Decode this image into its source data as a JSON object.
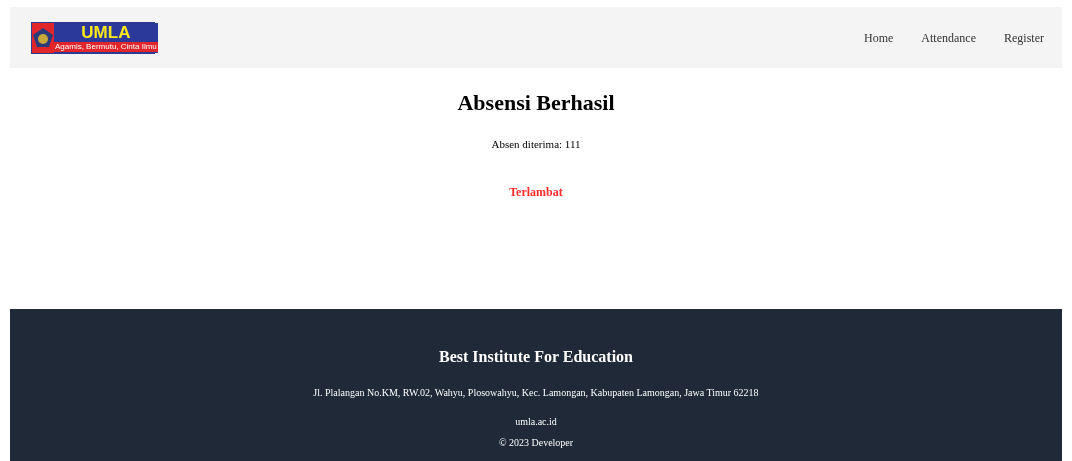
{
  "header": {
    "logo": {
      "text": "UMLA",
      "tagline": "Agamis, Bermutu, Cinta Ilmu"
    },
    "nav": [
      {
        "label": "Home"
      },
      {
        "label": "Attendance"
      },
      {
        "label": "Register"
      }
    ]
  },
  "main": {
    "title": "Absensi Berhasil",
    "message": "Absen diterima: 111",
    "status": {
      "text": "Terlambat",
      "color": "#ff2b2b"
    }
  },
  "footer": {
    "title": "Best Institute For Education",
    "address": "Jl. Plalangan No.KM, RW.02, Wahyu, Plosowahyu, Kec. Lamongan, Kabupaten Lamongan, Jawa Timur 62218",
    "website": "umla.ac.id",
    "copyright": "© 2023 Developer"
  }
}
